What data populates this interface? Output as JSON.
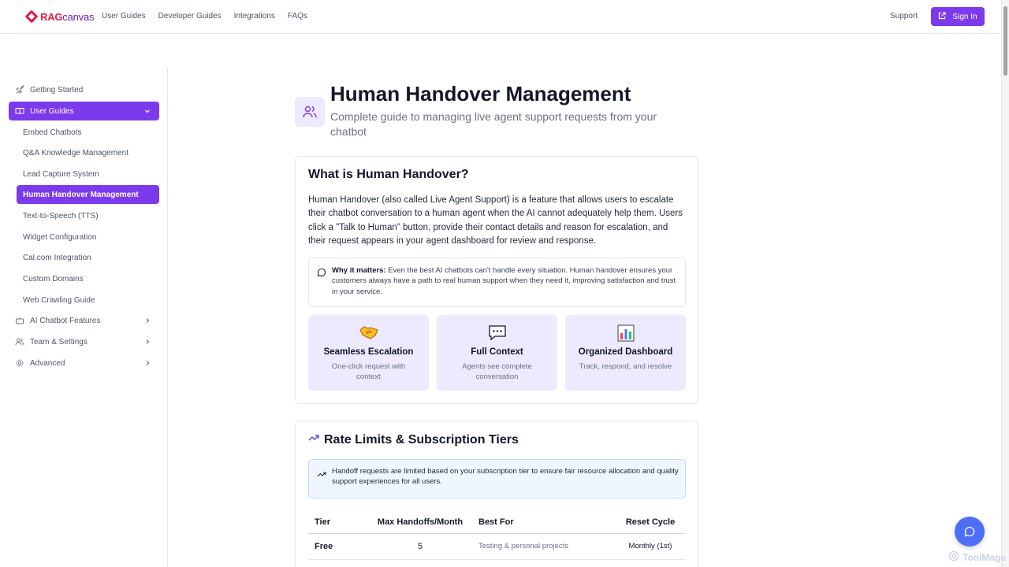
{
  "header": {
    "logo_rag": "RAG",
    "logo_canvas": "canvas",
    "nav": [
      "User Guides",
      "Developer Guides",
      "Integrations",
      "FAQs"
    ],
    "support": "Support",
    "sign_in": "Sign In"
  },
  "sidebar": {
    "getting_started": "Getting Started",
    "user_guides": "User Guides",
    "sub_items": [
      "Embed Chatbots",
      "Q&A Knowledge Management",
      "Lead Capture System",
      "Human Handover Management",
      "Text-to-Speech (TTS)",
      "Widget Configuration",
      "Cal.com Integration",
      "Custom Domains",
      "Web Crawling Guide"
    ],
    "ai_chatbot_features": "AI Chatbot Features",
    "team_settings": "Team & Settings",
    "advanced": "Advanced"
  },
  "page": {
    "title": "Human Handover Management",
    "subtitle": "Complete guide to managing live agent support requests from your chatbot"
  },
  "what_is": {
    "title": "What is Human Handover?",
    "body": "Human Handover (also called Live Agent Support) is a feature that allows users to escalate their chatbot conversation to a human agent when the AI cannot adequately help them. Users click a \"Talk to Human\" button, provide their contact details and reason for escalation, and their request appears in your agent dashboard for review and response.",
    "callout_bold": "Why it matters:",
    "callout_text": " Even the best AI chatbots can't handle every situation. Human handover ensures your customers always have a path to real human support when they need it, improving satisfaction and trust in your service.",
    "features": [
      {
        "icon": "handshake-emoji",
        "name": "Seamless Escalation",
        "desc": "One-click request with context"
      },
      {
        "icon": "speech-bubble-emoji",
        "name": "Full Context",
        "desc": "Agents see complete conversation"
      },
      {
        "icon": "bar-chart-emoji",
        "name": "Organized Dashboard",
        "desc": "Track, respond, and resolve"
      }
    ]
  },
  "rate_limits": {
    "title": "Rate Limits & Subscription Tiers",
    "info": "Handoff requests are limited based on your subscription tier to ensure fair resource allocation and quality support experiences for all users.",
    "headers": [
      "Tier",
      "Max Handoffs/Month",
      "Best For",
      "Reset Cycle"
    ],
    "rows": [
      {
        "tier": "Free",
        "max": "5",
        "best": "Testing & personal projects",
        "reset": "Monthly (1st)"
      }
    ]
  },
  "watermark": "ToolMage",
  "colors": {
    "accent": "#7c3aed",
    "accent_light": "#ede9fe",
    "fab": "#4f6ef7"
  }
}
